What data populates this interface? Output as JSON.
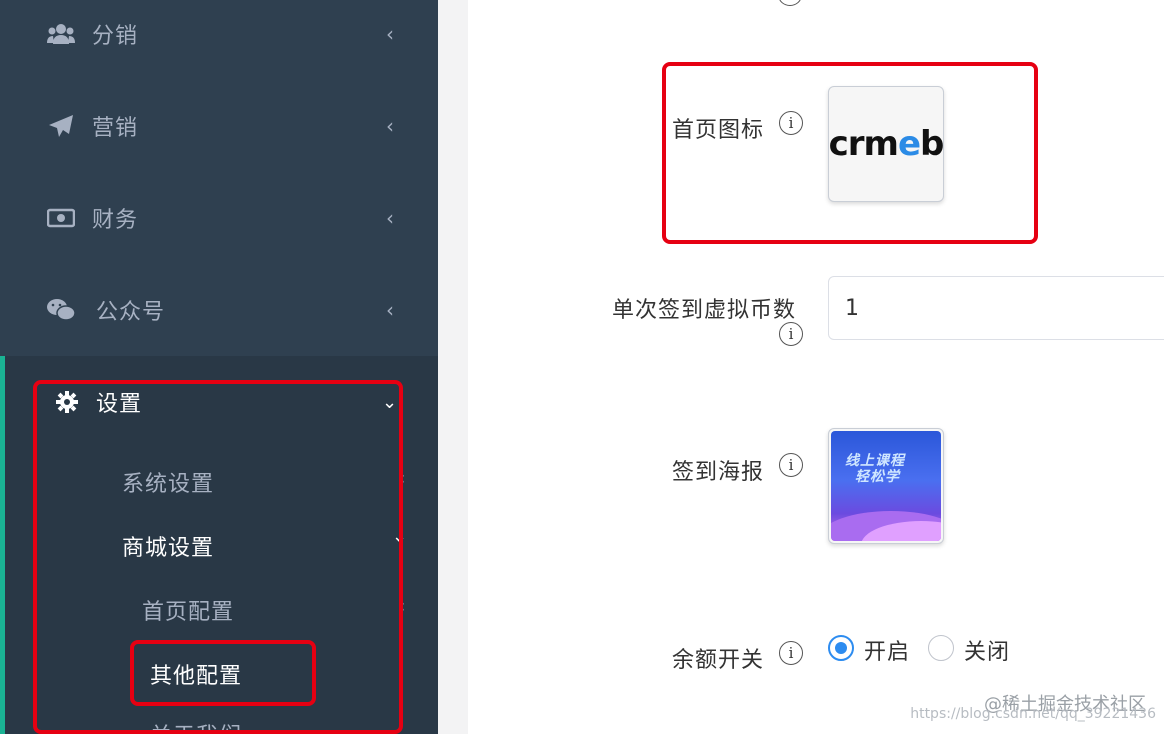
{
  "sidebar": {
    "items": [
      {
        "label": "分销",
        "icon": "users-icon"
      },
      {
        "label": "营销",
        "icon": "paper-plane-icon"
      },
      {
        "label": "财务",
        "icon": "money-icon"
      },
      {
        "label": "公众号",
        "icon": "wechat-icon"
      }
    ],
    "active": {
      "label": "设置",
      "icon": "gear-icon"
    },
    "sub": {
      "system": "系统设置",
      "mall": "商城设置",
      "home_config": "首页配置",
      "other_config": "其他配置",
      "about_us": "关于我们"
    }
  },
  "form": {
    "home_icon_label": "首页图标",
    "home_icon_logo": "crmeb",
    "signin_coin_label": "单次签到虚拟币数",
    "signin_coin_value": "1",
    "signin_poster_label": "签到海报",
    "poster_title_line1": "线上课程",
    "poster_title_line2": "轻松学",
    "balance_switch_label": "余额开关",
    "balance_on": "开启",
    "balance_off": "关闭",
    "balance_selected": "开启",
    "info_glyph": "i"
  },
  "watermark": {
    "text": "@稀土掘金技术社区",
    "url": "https://blog.csdn.net/qq_39221436"
  },
  "colors": {
    "sidebar_bg": "#2f4050",
    "highlight": "#e60012",
    "radio_active": "#2d8cf0"
  }
}
